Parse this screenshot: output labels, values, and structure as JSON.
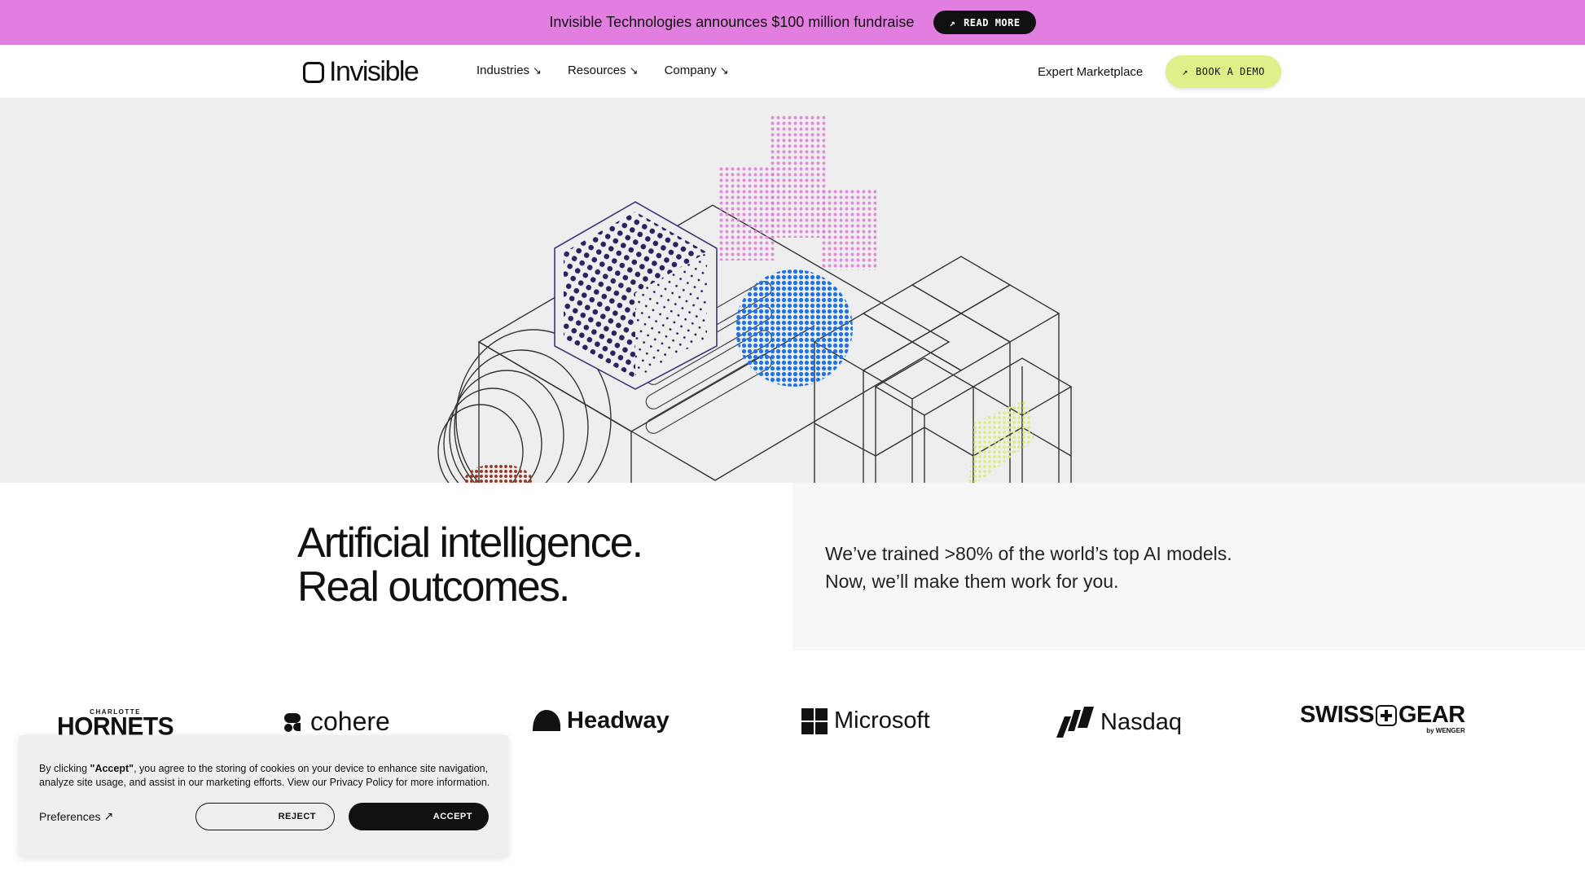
{
  "announcement": {
    "text": "Invisible Technologies announces $100 million fundraise",
    "cta_label": "READ MORE"
  },
  "nav": {
    "logo_text": "Invisible",
    "links": [
      {
        "label": "Industries",
        "icon": "arrow-down-right-icon"
      },
      {
        "label": "Resources",
        "icon": "arrow-down-right-icon"
      },
      {
        "label": "Company",
        "icon": "arrow-down-right-icon"
      }
    ],
    "expert_label": "Expert Marketplace",
    "demo_label": "BOOK A DEMO"
  },
  "hero": {
    "headline_line1": "Artificial intelligence.",
    "headline_line2": "Real outcomes.",
    "subline_line1": "We’ve trained >80% of the world’s top AI models.",
    "subline_line2": "Now, we’ll make them work for you."
  },
  "logos": {
    "hornets_small": "CHARLOTTE",
    "hornets_big": "HORNETS",
    "cohere": "cohere",
    "headway": "Headway",
    "microsoft": "Microsoft",
    "nasdaq": "Nasdaq",
    "swiss_gear_left": "SWISS",
    "swiss_gear_right": "GEAR",
    "swiss_gear_by": "by WENGER"
  },
  "cookie": {
    "text_bold": "\"Accept\"",
    "text_prefix": "By clicking ",
    "text_suffix": ", you agree to the storing of cookies on your device to enhance site navigation, analyze site usage, and assist in our marketing efforts. View our Privacy Policy for more information.",
    "preferences_label": "Preferences",
    "reject_label": "REJECT",
    "accept_label": "ACCEPT"
  },
  "colors": {
    "announcement_bg": "#e17ee0",
    "lime_accent": "#dff08b",
    "hero_bg": "#eeeeee",
    "dark": "#111111",
    "pink_dots": "#e07ad8",
    "blue_dots": "#1c74e8",
    "navy_dots": "#26235e",
    "lime_dots": "#d9ee72"
  }
}
